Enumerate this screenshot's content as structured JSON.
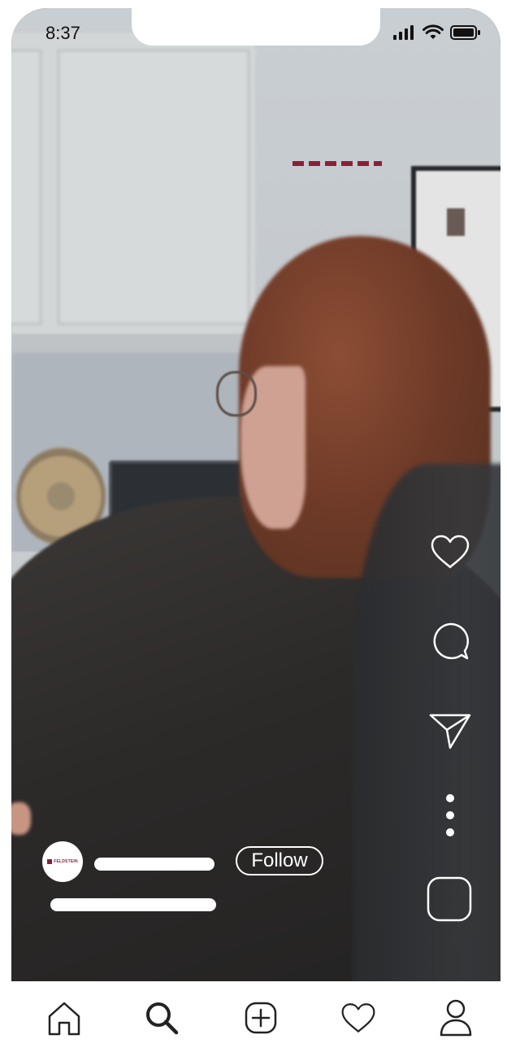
{
  "status_bar": {
    "time": "8:37",
    "icons": [
      "signal-icon",
      "wifi-icon",
      "battery-icon"
    ]
  },
  "video": {
    "description_hidden": true,
    "account_logo_text": "FELDSTEIN"
  },
  "actions": {
    "items": [
      "heart-icon",
      "comment-icon",
      "share-icon",
      "more-icon",
      "audio-thumbnail"
    ]
  },
  "post": {
    "follow_label": "Follow"
  },
  "bottom_nav": {
    "items": [
      "home-icon",
      "search-icon",
      "create-icon",
      "activity-icon",
      "profile-icon"
    ],
    "active": "search-icon"
  },
  "colors": {
    "brand": "#8d1f38",
    "overlay_text": "#ffffff",
    "nav_icons": "#222222"
  }
}
